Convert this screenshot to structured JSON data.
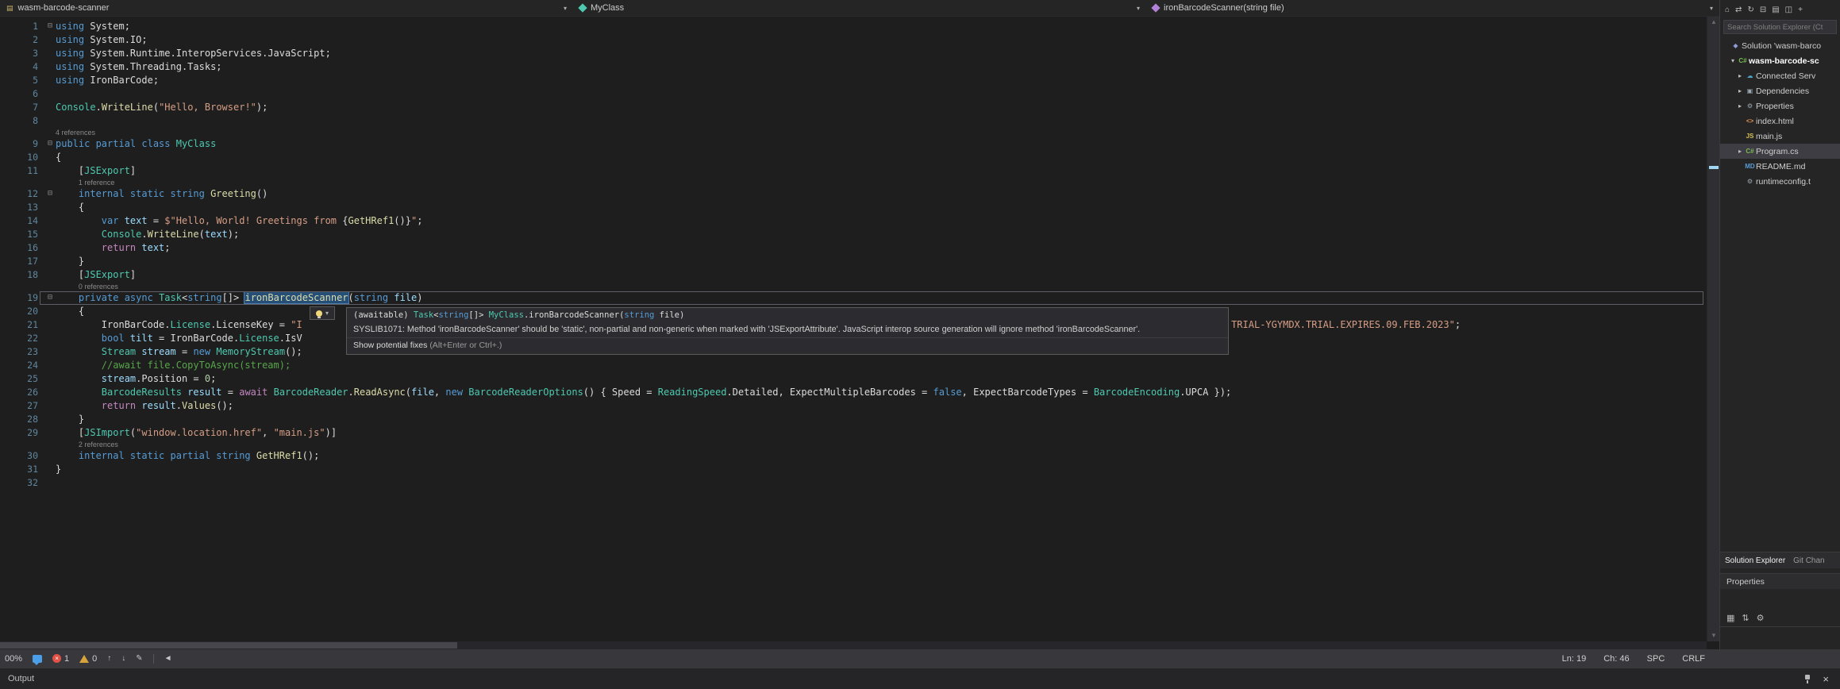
{
  "breadcrumb": {
    "project": "wasm-barcode-scanner",
    "type": "MyClass",
    "member": "ironBarcodeScanner(string file)"
  },
  "icons": {
    "project": "▤",
    "chevron_down": "▾",
    "arrow_up": "↑",
    "arrow_down": "↓",
    "pen": "✎",
    "back": "◄",
    "close": "×",
    "error_x": "×",
    "scroll_up": "▲",
    "scroll_down": "▼"
  },
  "editor": {
    "lines": [
      {
        "n": 1,
        "fold": true,
        "tokens": [
          [
            "k",
            "using "
          ],
          [
            "p",
            "System;"
          ]
        ]
      },
      {
        "n": 2,
        "tokens": [
          [
            "k",
            "using "
          ],
          [
            "p",
            "System.IO;"
          ]
        ]
      },
      {
        "n": 3,
        "tokens": [
          [
            "k",
            "using "
          ],
          [
            "p",
            "System.Runtime.InteropServices.JavaScript;"
          ]
        ]
      },
      {
        "n": 4,
        "tokens": [
          [
            "k",
            "using "
          ],
          [
            "p",
            "System.Threading.Tasks;"
          ]
        ]
      },
      {
        "n": 5,
        "tokens": [
          [
            "k",
            "using "
          ],
          [
            "p",
            "IronBarCode;"
          ]
        ]
      },
      {
        "n": 6,
        "tokens": []
      },
      {
        "n": 7,
        "tokens": [
          [
            "t",
            "Console"
          ],
          [
            "p",
            "."
          ],
          [
            "m",
            "WriteLine"
          ],
          [
            "p",
            "("
          ],
          [
            "s",
            "\"Hello, Browser!\""
          ],
          [
            "p",
            ");"
          ]
        ]
      },
      {
        "n": 8,
        "tokens": []
      },
      {
        "lens": "4 references",
        "indent": 0
      },
      {
        "n": 9,
        "fold": true,
        "tokens": [
          [
            "k",
            "public partial class "
          ],
          [
            "t",
            "MyClass"
          ]
        ]
      },
      {
        "n": 10,
        "tokens": [
          [
            "p",
            "{"
          ]
        ]
      },
      {
        "n": 11,
        "tokens": [
          [
            "p",
            "    ["
          ],
          [
            "t",
            "JSExport"
          ],
          [
            "p",
            "]"
          ]
        ]
      },
      {
        "lens": "1 reference",
        "indent": 4
      },
      {
        "n": 12,
        "fold": true,
        "tokens": [
          [
            "p",
            "    "
          ],
          [
            "k",
            "internal static string "
          ],
          [
            "m",
            "Greeting"
          ],
          [
            "p",
            "()"
          ]
        ]
      },
      {
        "n": 13,
        "tokens": [
          [
            "p",
            "    {"
          ]
        ]
      },
      {
        "n": 14,
        "tokens": [
          [
            "p",
            "        "
          ],
          [
            "k",
            "var "
          ],
          [
            "v",
            "text"
          ],
          [
            "p",
            " = "
          ],
          [
            "s",
            "$\"Hello, World! Greetings from "
          ],
          [
            "p",
            "{"
          ],
          [
            "m",
            "GetHRef1"
          ],
          [
            "p",
            "()}"
          ],
          [
            "s",
            "\""
          ],
          [
            "p",
            ";"
          ]
        ]
      },
      {
        "n": 15,
        "tokens": [
          [
            "p",
            "        "
          ],
          [
            "t",
            "Console"
          ],
          [
            "p",
            "."
          ],
          [
            "m",
            "WriteLine"
          ],
          [
            "p",
            "("
          ],
          [
            "v",
            "text"
          ],
          [
            "p",
            ");"
          ]
        ]
      },
      {
        "n": 16,
        "tokens": [
          [
            "p",
            "        "
          ],
          [
            "c",
            "return "
          ],
          [
            "v",
            "text"
          ],
          [
            "p",
            ";"
          ]
        ]
      },
      {
        "n": 17,
        "tokens": [
          [
            "p",
            "    }"
          ]
        ]
      },
      {
        "n": 18,
        "tokens": [
          [
            "p",
            "    ["
          ],
          [
            "t",
            "JSExport"
          ],
          [
            "p",
            "]"
          ]
        ]
      },
      {
        "lens": "0 references",
        "indent": 4
      },
      {
        "n": 19,
        "fold": true,
        "cur": true,
        "tokens": [
          [
            "p",
            "    "
          ],
          [
            "k",
            "private async "
          ],
          [
            "t",
            "Task"
          ],
          [
            "p",
            "<"
          ],
          [
            "k",
            "string"
          ],
          [
            "p",
            "[]> "
          ],
          [
            "hl",
            "ironBarcodeScanner"
          ],
          [
            "p",
            "("
          ],
          [
            "k",
            "string"
          ],
          [
            "p",
            " "
          ],
          [
            "v",
            "file"
          ],
          [
            "p",
            ")"
          ]
        ]
      },
      {
        "n": 20,
        "tokens": [
          [
            "p",
            "    {"
          ]
        ]
      },
      {
        "n": 21,
        "tokens": [
          [
            "p",
            "        IronBarCode."
          ],
          [
            "t",
            "License"
          ],
          [
            "p",
            ".LicenseKey = "
          ],
          [
            "s",
            "\"I"
          ],
          [
            "gap",
            162
          ],
          [
            "s",
            "TRIAL-YGYMDX.TRIAL.EXPIRES.09.FEB.2023\""
          ],
          [
            "p",
            ";"
          ]
        ]
      },
      {
        "n": 22,
        "tokens": [
          [
            "p",
            "        "
          ],
          [
            "k",
            "bool "
          ],
          [
            "v",
            "tilt"
          ],
          [
            "p",
            " = IronBarCode."
          ],
          [
            "t",
            "License"
          ],
          [
            "p",
            ".IsV"
          ]
        ]
      },
      {
        "n": 23,
        "tokens": [
          [
            "p",
            "        "
          ],
          [
            "t",
            "Stream"
          ],
          [
            "p",
            " "
          ],
          [
            "v",
            "stream"
          ],
          [
            "p",
            " = "
          ],
          [
            "k",
            "new"
          ],
          [
            "p",
            " "
          ],
          [
            "t",
            "MemoryStream"
          ],
          [
            "p",
            "();"
          ]
        ]
      },
      {
        "n": 24,
        "tokens": [
          [
            "cm",
            "        //await file.CopyToAsync(stream);"
          ]
        ]
      },
      {
        "n": 25,
        "tokens": [
          [
            "p",
            "        "
          ],
          [
            "v",
            "stream"
          ],
          [
            "p",
            ".Position = "
          ],
          [
            "n2",
            "0"
          ],
          [
            "p",
            ";"
          ]
        ]
      },
      {
        "n": 26,
        "tokens": [
          [
            "p",
            "        "
          ],
          [
            "t",
            "BarcodeResults"
          ],
          [
            "p",
            " "
          ],
          [
            "v",
            "result"
          ],
          [
            "p",
            " = "
          ],
          [
            "c",
            "await"
          ],
          [
            "p",
            " "
          ],
          [
            "t",
            "BarcodeReader"
          ],
          [
            "p",
            "."
          ],
          [
            "m",
            "ReadAsync"
          ],
          [
            "p",
            "("
          ],
          [
            "v",
            "file"
          ],
          [
            "p",
            ", "
          ],
          [
            "k",
            "new"
          ],
          [
            "p",
            " "
          ],
          [
            "t",
            "BarcodeReaderOptions"
          ],
          [
            "p",
            "() { Speed = "
          ],
          [
            "t",
            "ReadingSpeed"
          ],
          [
            "p",
            ".Detailed, ExpectMultipleBarcodes = "
          ],
          [
            "k",
            "false"
          ],
          [
            "p",
            ", ExpectBarcodeTypes = "
          ],
          [
            "t",
            "BarcodeEncoding"
          ],
          [
            "p",
            ".UPCA });"
          ]
        ]
      },
      {
        "n": 27,
        "tokens": [
          [
            "p",
            "        "
          ],
          [
            "c",
            "return "
          ],
          [
            "v",
            "result"
          ],
          [
            "p",
            "."
          ],
          [
            "m",
            "Values"
          ],
          [
            "p",
            "();"
          ]
        ]
      },
      {
        "n": 28,
        "tokens": [
          [
            "p",
            "    }"
          ]
        ]
      },
      {
        "n": 29,
        "tokens": [
          [
            "p",
            "    ["
          ],
          [
            "t",
            "JSImport"
          ],
          [
            "p",
            "("
          ],
          [
            "s",
            "\"window.location.href\""
          ],
          [
            "p",
            ", "
          ],
          [
            "s",
            "\"main.js\""
          ],
          [
            "p",
            ")]"
          ]
        ]
      },
      {
        "lens": "2 references",
        "indent": 4
      },
      {
        "n": 30,
        "tokens": [
          [
            "p",
            "    "
          ],
          [
            "k",
            "internal static partial string "
          ],
          [
            "m",
            "GetHRef1"
          ],
          [
            "p",
            "();"
          ]
        ]
      },
      {
        "n": 31,
        "tokens": [
          [
            "p",
            "}"
          ]
        ]
      },
      {
        "n": 32,
        "tokens": []
      }
    ]
  },
  "quick_info": {
    "signature": [
      [
        "p",
        "(awaitable) "
      ],
      [
        "t",
        "Task"
      ],
      [
        "p",
        "<"
      ],
      [
        "k",
        "string"
      ],
      [
        "p",
        "[]> "
      ],
      [
        "t",
        "MyClass"
      ],
      [
        "p",
        ".ironBarcodeScanner("
      ],
      [
        "k",
        "string"
      ],
      [
        "p",
        " file)"
      ]
    ],
    "message": "SYSLIB1071: Method 'ironBarcodeScanner' should be 'static', non-partial and non-generic when marked with 'JSExportAttribute'. JavaScript interop source generation will ignore method 'ironBarcodeScanner'.",
    "fix_label": "Show potential fixes",
    "fix_shortcut": "(Alt+Enter or Ctrl+.)"
  },
  "solution_explorer": {
    "toolbar_icons": [
      {
        "name": "home-icon",
        "glyph": "⌂"
      },
      {
        "name": "switch-views-icon",
        "glyph": "⇄"
      },
      {
        "name": "refresh-icon",
        "glyph": "↻"
      },
      {
        "name": "collapse-all-icon",
        "glyph": "⊟"
      },
      {
        "name": "show-all-files-icon",
        "glyph": "▤"
      },
      {
        "name": "preview-selected-icon",
        "glyph": "◫"
      },
      {
        "name": "add-icon",
        "glyph": "+"
      }
    ],
    "search_placeholder": "Search Solution Explorer (Ct",
    "items": [
      {
        "label": "Solution 'wasm-barco",
        "icon": "solution-icon",
        "glyph": "◆",
        "color": "#8f9bd4",
        "indent": 0,
        "expander": ""
      },
      {
        "label": "wasm-barcode-sc",
        "icon": "csharp-project-icon",
        "glyph": "C#",
        "color": "#7cbb54",
        "indent": 1,
        "expander": "▾",
        "bold": true
      },
      {
        "label": "Connected Serv",
        "icon": "connected-services-icon",
        "glyph": "☁",
        "color": "#4aa8c8",
        "indent": 2,
        "expander": "▸"
      },
      {
        "label": "Dependencies",
        "icon": "dependencies-icon",
        "glyph": "▣",
        "color": "#9aa7b0",
        "indent": 2,
        "expander": "▸"
      },
      {
        "label": "Properties",
        "icon": "properties-folder-icon",
        "glyph": "⚙",
        "color": "#9aa7b0",
        "indent": 2,
        "expander": "▸"
      },
      {
        "label": "index.html",
        "icon": "html-file-icon",
        "glyph": "<>",
        "color": "#e8934a",
        "indent": 2,
        "expander": ""
      },
      {
        "label": "main.js",
        "icon": "js-file-icon",
        "glyph": "JS",
        "color": "#d4c054",
        "indent": 2,
        "expander": ""
      },
      {
        "label": "Program.cs",
        "icon": "csharp-file-icon",
        "glyph": "C#",
        "color": "#7cbb54",
        "indent": 2,
        "expander": "▸",
        "selected": true
      },
      {
        "label": "README.md",
        "icon": "markdown-file-icon",
        "glyph": "MD",
        "color": "#5a9bd4",
        "indent": 2,
        "expander": ""
      },
      {
        "label": "runtimeconfig.t",
        "icon": "config-file-icon",
        "glyph": "⚙",
        "color": "#9aa7b0",
        "indent": 2,
        "expander": ""
      }
    ],
    "tabs": [
      {
        "label": "Solution Explorer",
        "active": true
      },
      {
        "label": "Git Chan",
        "active": false
      }
    ],
    "properties_panel": {
      "title": "Properties",
      "toolbar_icons": [
        {
          "name": "categorized-icon",
          "glyph": "▦"
        },
        {
          "name": "sort-alphabetical-icon",
          "glyph": "⇅"
        },
        {
          "name": "property-pages-icon",
          "glyph": "⚙"
        }
      ]
    }
  },
  "status_bar": {
    "zoom": "00%",
    "errors": "1",
    "warnings": "0",
    "line": "Ln: 19",
    "column": "Ch: 46",
    "spaces": "SPC",
    "line_ending": "CRLF"
  },
  "output": {
    "title": "Output"
  }
}
